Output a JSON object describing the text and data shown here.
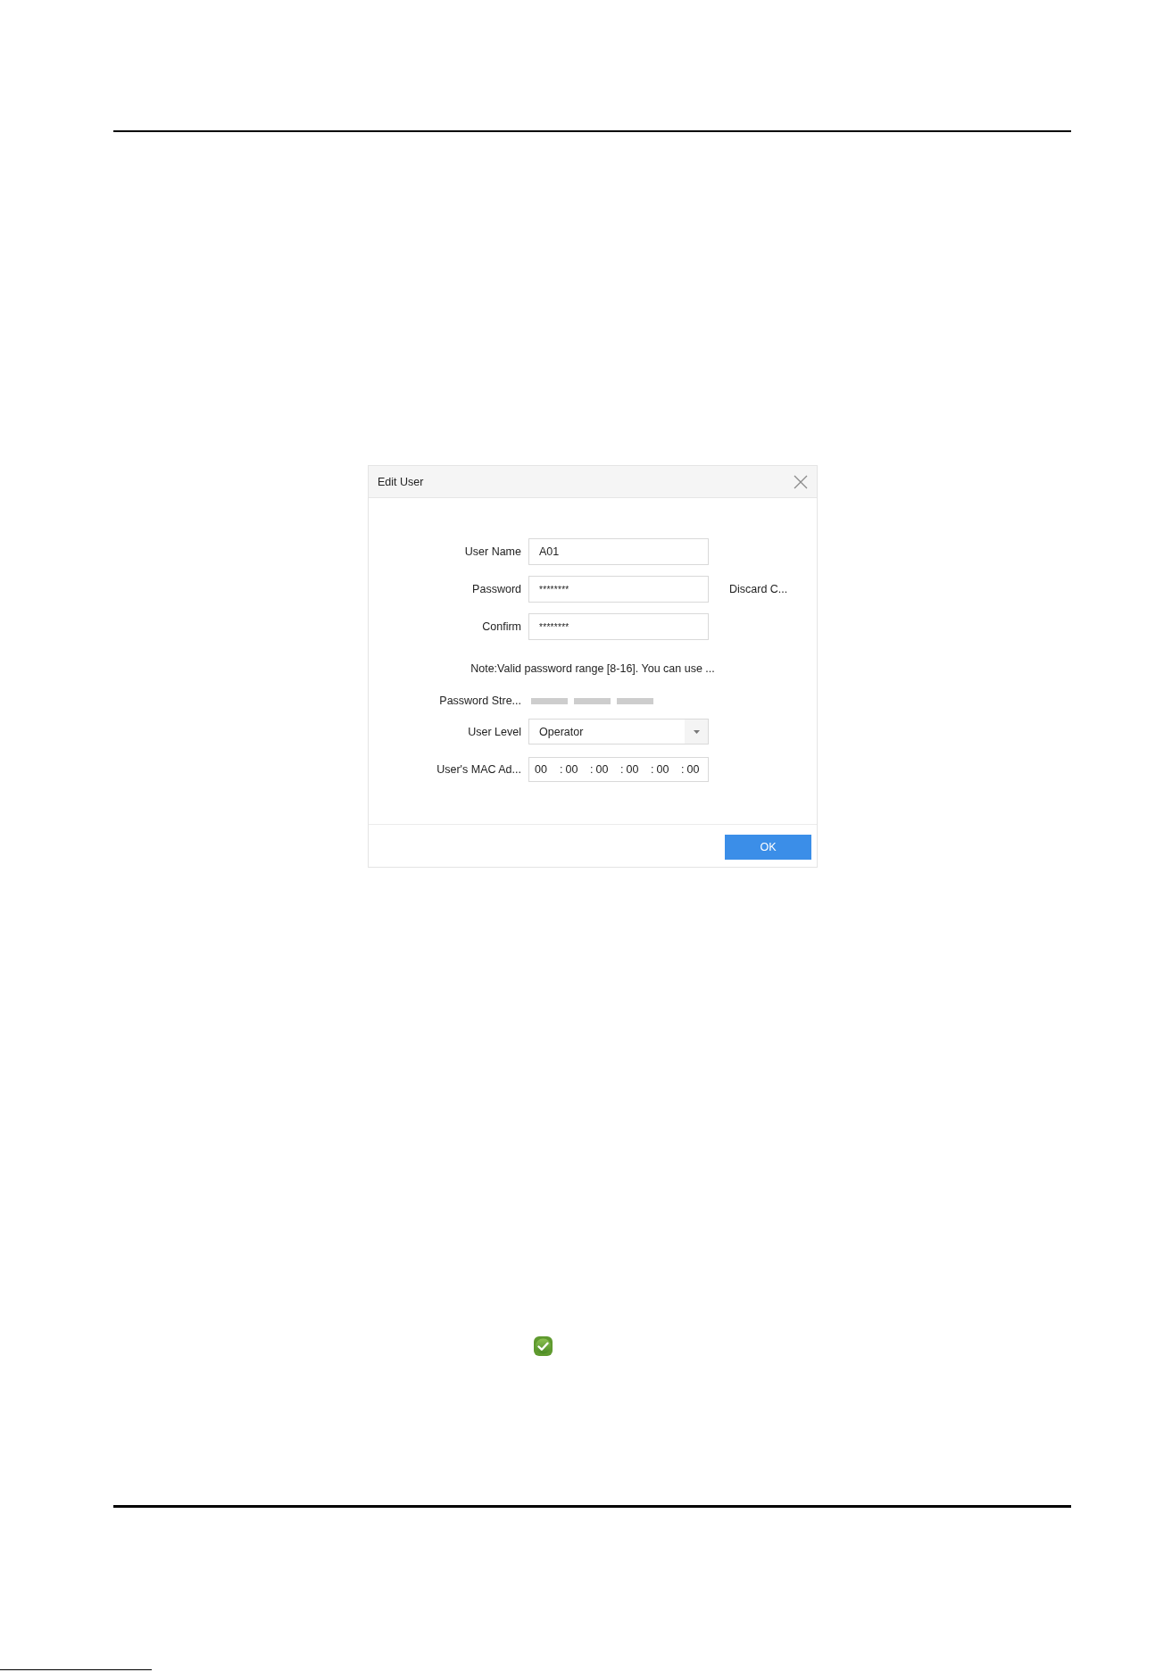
{
  "dialog": {
    "title": "Edit User",
    "fields": [
      {
        "kind": "text",
        "label": "User Name",
        "value": "A01"
      },
      {
        "kind": "password",
        "label": "Password",
        "value": "********",
        "action": "Discard C..."
      },
      {
        "kind": "password",
        "label": "Confirm",
        "value": "********"
      }
    ],
    "note": "Note:Valid password range [8-16]. You can use ...",
    "password_strength": {
      "label": "Password Stre...",
      "level": 0
    },
    "user_level": {
      "label": "User Level",
      "value": "Operator"
    },
    "mac_address": {
      "label": "User's MAC Ad...",
      "segments": [
        {
          "value": "00"
        },
        {
          "separator": ":",
          "value": "00"
        },
        {
          "separator": ":",
          "value": "00"
        },
        {
          "separator": ":",
          "value": "00"
        },
        {
          "separator": ":",
          "value": "00"
        },
        {
          "separator": ":",
          "value": "00"
        }
      ]
    },
    "ok_button": {
      "label": "OK"
    }
  }
}
